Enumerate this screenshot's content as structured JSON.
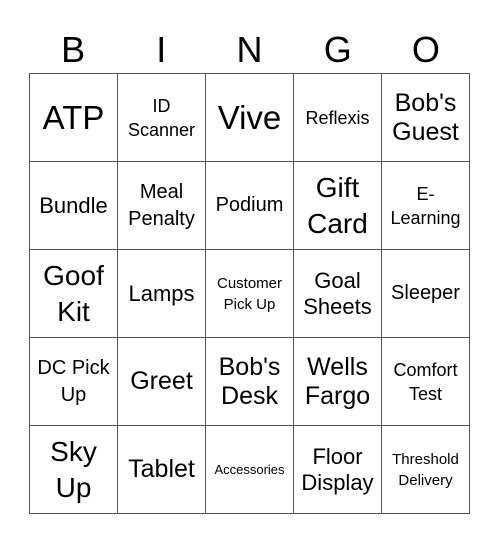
{
  "header": [
    "B",
    "I",
    "N",
    "G",
    "O"
  ],
  "cells": [
    [
      {
        "text": "ATP",
        "size": "s-xl"
      },
      {
        "text": "ID Scanner",
        "size": "s-s"
      },
      {
        "text": "Vive",
        "size": "s-xl"
      },
      {
        "text": "Reflexis",
        "size": "s-s"
      },
      {
        "text": "Bob's Guest",
        "size": "s-lm"
      }
    ],
    [
      {
        "text": "Bundle",
        "size": "s-m"
      },
      {
        "text": "Meal Penalty",
        "size": "s-ms"
      },
      {
        "text": "Podium",
        "size": "s-ms"
      },
      {
        "text": "Gift Card",
        "size": "s-l"
      },
      {
        "text": "E-Learning",
        "size": "s-s"
      }
    ],
    [
      {
        "text": "Goof Kit",
        "size": "s-l"
      },
      {
        "text": "Lamps",
        "size": "s-m"
      },
      {
        "text": "Customer Pick Up",
        "size": "s-xs"
      },
      {
        "text": "Goal Sheets",
        "size": "s-m"
      },
      {
        "text": "Sleeper",
        "size": "s-ms"
      }
    ],
    [
      {
        "text": "DC Pick Up",
        "size": "s-ms"
      },
      {
        "text": "Greet",
        "size": "s-lm"
      },
      {
        "text": "Bob's Desk",
        "size": "s-lm"
      },
      {
        "text": "Wells Fargo",
        "size": "s-lm"
      },
      {
        "text": "Comfort Test",
        "size": "s-s"
      }
    ],
    [
      {
        "text": "Sky Up",
        "size": "s-l"
      },
      {
        "text": "Tablet",
        "size": "s-lm"
      },
      {
        "text": "Accessories",
        "size": "s-xxs"
      },
      {
        "text": "Floor Display",
        "size": "s-m"
      },
      {
        "text": "Threshold Delivery",
        "size": "s-xs"
      }
    ]
  ]
}
